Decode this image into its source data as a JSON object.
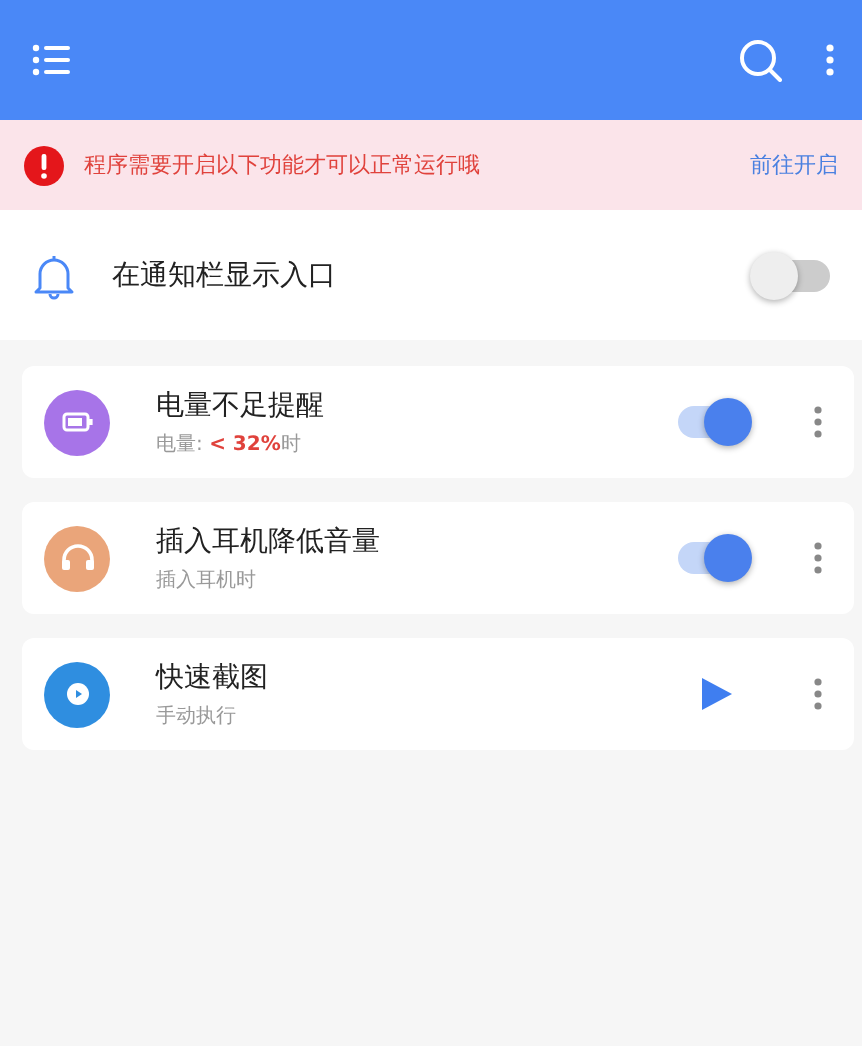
{
  "banner": {
    "message": "程序需要开启以下功能才可以正常运行哦",
    "action": "前往开启"
  },
  "notification": {
    "label": "在通知栏显示入口",
    "on": false
  },
  "tasks": [
    {
      "title": "电量不足提醒",
      "subtitle": [
        {
          "text": "电量: ",
          "highlight": false
        },
        {
          "text": "< 32%",
          "highlight": true
        },
        {
          "text": "时",
          "highlight": false
        }
      ],
      "kind": "toggle",
      "on": true,
      "color": "#a774e8"
    },
    {
      "title": "插入耳机降低音量",
      "subtitle": [
        {
          "text": "插入耳机时",
          "highlight": false
        }
      ],
      "kind": "toggle",
      "on": true,
      "color": "#eaa57a"
    },
    {
      "title": "快速截图",
      "subtitle": [
        {
          "text": "手动执行",
          "highlight": false
        }
      ],
      "kind": "run",
      "color": "#2f8ee0"
    }
  ]
}
